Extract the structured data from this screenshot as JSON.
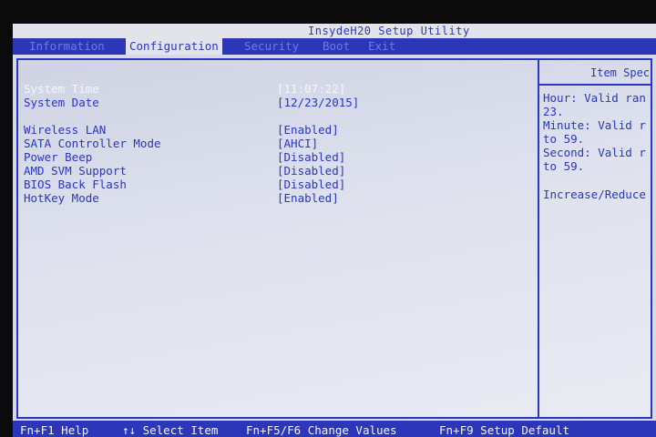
{
  "title": "InsydeH20 Setup Utility",
  "tabs": [
    {
      "label": "Information",
      "active": false
    },
    {
      "label": "Configuration",
      "active": true
    },
    {
      "label": "Security",
      "active": false
    },
    {
      "label": "Boot",
      "active": false
    },
    {
      "label": "Exit",
      "active": false
    }
  ],
  "settings": [
    {
      "label": "System Time",
      "value": "[11:07:22]",
      "selected": true
    },
    {
      "label": "System Date",
      "value": "[12/23/2015]",
      "selected": false
    },
    {
      "label": "Wireless LAN",
      "value": "[Enabled]",
      "selected": false
    },
    {
      "label": "SATA Controller Mode",
      "value": "[AHCI]",
      "selected": false
    },
    {
      "label": "Power Beep",
      "value": "[Disabled]",
      "selected": false
    },
    {
      "label": "AMD SVM Support",
      "value": "[Disabled]",
      "selected": false
    },
    {
      "label": "BIOS Back Flash",
      "value": "[Disabled]",
      "selected": false
    },
    {
      "label": "HotKey Mode",
      "value": "[Enabled]",
      "selected": false
    }
  ],
  "help": {
    "heading": "Item Speci",
    "lines": [
      "Hour: Valid ran",
      "23.",
      "Minute: Valid r",
      "to 59.",
      "Second: Valid r",
      "to 59.",
      "Increase/Reduce"
    ]
  },
  "footer": [
    {
      "key": "Fn+F1",
      "desc": "Help"
    },
    {
      "key": "↑↓",
      "desc": "Select Item"
    },
    {
      "key": "Fn+F5/F6",
      "desc": "Change Values"
    },
    {
      "key": "Fn+F9",
      "desc": "Setup Default"
    }
  ],
  "colors": {
    "accent_blue": "#2a36c4",
    "panel_bg": "#d6d9e6",
    "highlight_text": "#f4f5fb"
  }
}
